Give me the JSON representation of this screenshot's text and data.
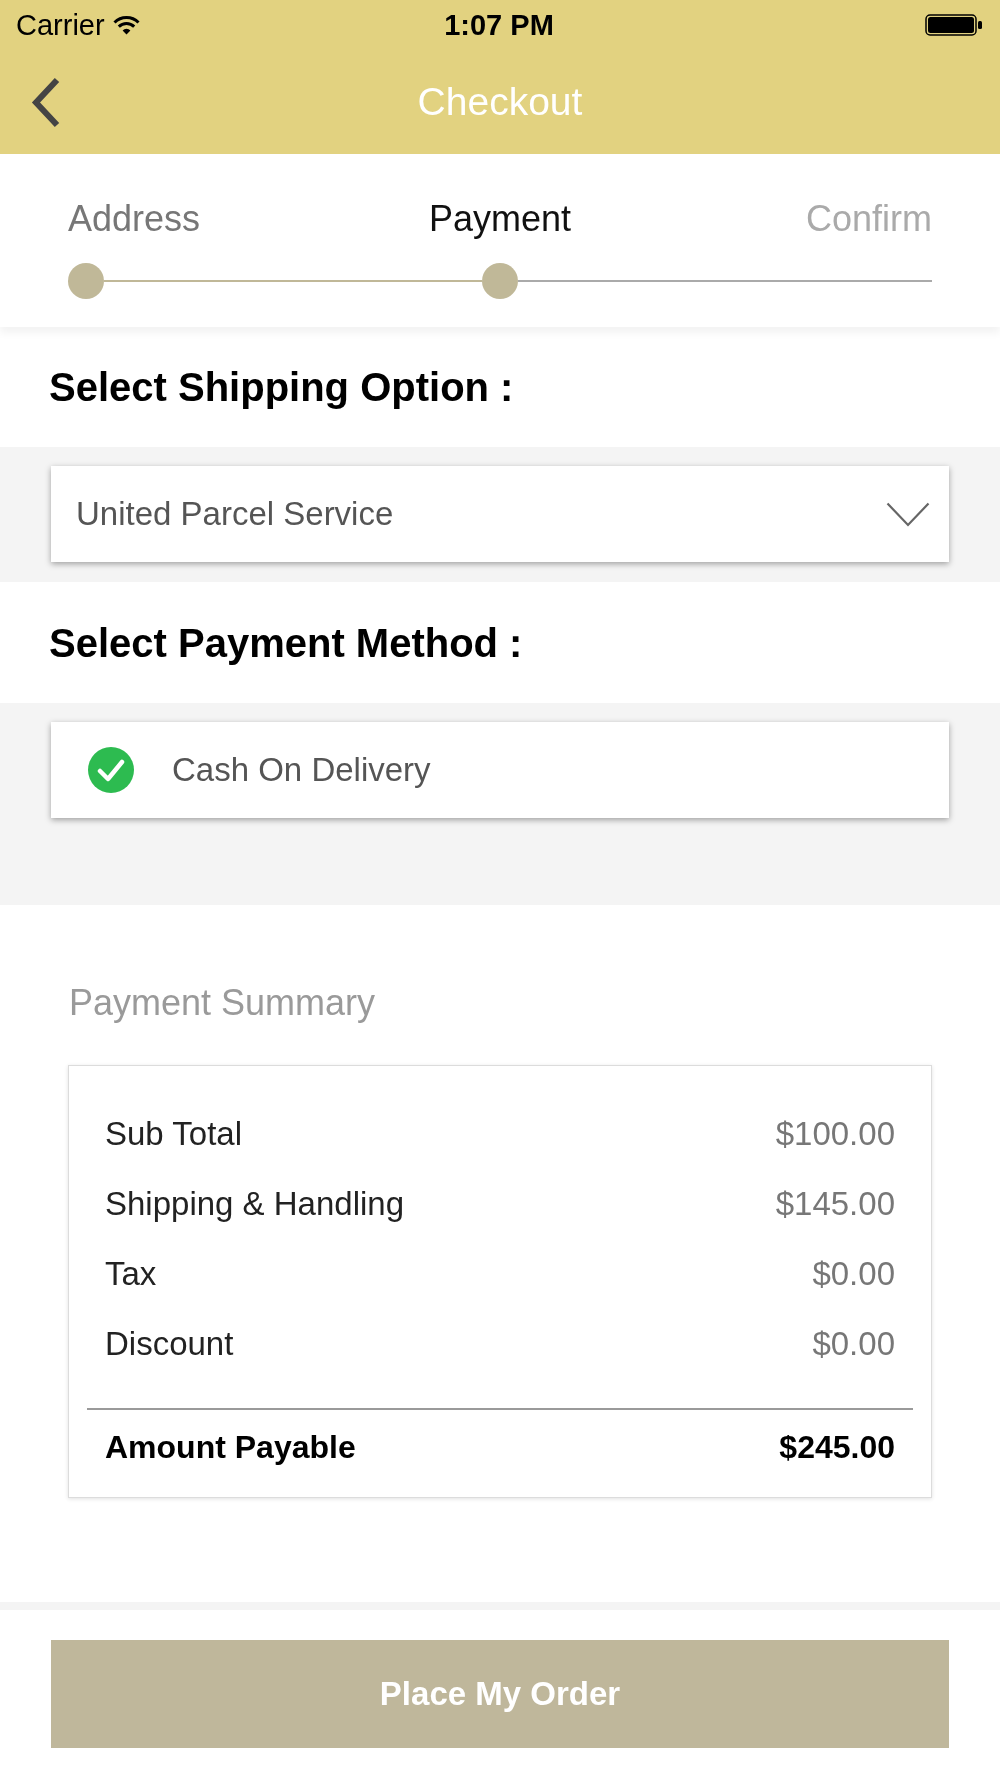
{
  "status_bar": {
    "carrier": "Carrier",
    "time": "1:07 PM"
  },
  "nav_bar": {
    "title": "Checkout"
  },
  "steps": [
    {
      "label": "Address",
      "completed": true,
      "selected": false
    },
    {
      "label": "Payment",
      "completed": false,
      "selected": true
    },
    {
      "label": "Confirm",
      "completed": false,
      "selected": false
    }
  ],
  "shipping": {
    "heading": "Select Shipping Option :",
    "value": "United Parcel Service"
  },
  "payment": {
    "heading": "Select Payment Method :",
    "options": [
      {
        "label": "Cash On Delivery",
        "checked": true
      }
    ]
  },
  "summary": {
    "title": "Payment Summary",
    "rows": [
      {
        "label": "Sub Total",
        "value": "$100.00"
      },
      {
        "label": "Shipping & Handling",
        "value": "$145.00"
      },
      {
        "label": "Tax",
        "value": "$0.00"
      },
      {
        "label": "Discount",
        "value": "$0.00"
      }
    ],
    "total": {
      "label": "Amount Payable",
      "value": "$245.00"
    }
  },
  "primary_button": {
    "label": "Place My Order"
  }
}
